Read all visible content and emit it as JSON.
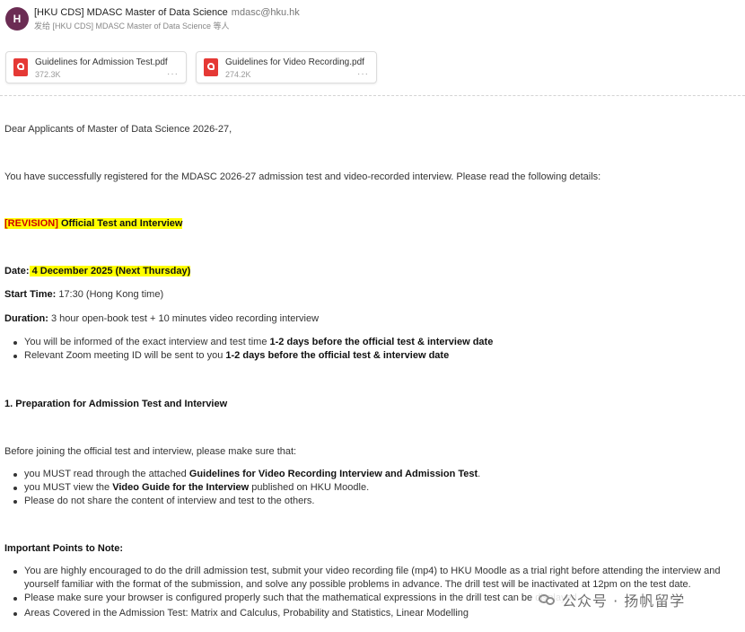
{
  "header": {
    "avatar_letter": "H",
    "subject": "[HKU CDS] MDASC Master of Data Science",
    "sender": "mdasc@hku.hk",
    "to_line": "发给 [HKU CDS] MDASC Master of Data Science 等人"
  },
  "attachments": [
    {
      "name": "Guidelines for Admission Test.pdf",
      "size": "372.3K",
      "more": "···"
    },
    {
      "name": "Guidelines for Video Recording.pdf",
      "size": "274.2K",
      "more": "···"
    }
  ],
  "email": {
    "greeting": "Dear Applicants of Master of Data Science 2026-27,",
    "intro": "You have successfully registered for the MDASC 2026-27 admission test and video-recorded interview. Please read the following details:",
    "revision_tag": "[REVISION]",
    "revision_title": " Official Test and Interview",
    "date_label": "Date:",
    "date_value": " 4 December 2025 (Next Thursday)",
    "start_label": "Start Time:",
    "start_value": " 17:30 (Hong Kong time)",
    "duration_label": "Duration:",
    "duration_value": " 3 hour open-book test + 10 minutes video recording interview",
    "bullets1": [
      {
        "pre": "You will be informed of the exact interview and test time ",
        "bold": "1-2 days before the official test & interview date"
      },
      {
        "pre": "Relevant Zoom meeting ID will be sent to you ",
        "bold": "1-2 days before the official test & interview date"
      }
    ],
    "section1_title": "1. Preparation for Admission Test and Interview",
    "before_text": "Before joining the official test and interview, please make sure that:",
    "bullets2": [
      {
        "pre": "you MUST read through the attached ",
        "bold": "Guidelines for Video Recording Interview and Admission Test",
        "post": "."
      },
      {
        "pre": "you MUST view the ",
        "bold": "Video Guide for the Interview",
        "post": " published on HKU Moodle."
      },
      {
        "pre": "Please do not share the content of interview and test to the others.",
        "bold": "",
        "post": ""
      }
    ],
    "important_title": "Important Points to Note:",
    "bullets3": [
      "You are highly encouraged to do the drill admission test, submit your video recording file (mp4) to HKU Moodle as a trial right before attending the interview and",
      "Please make sure your browser is configured properly such that the mathematical expressions in the drill test can be displayed.",
      "Areas Covered in the Admission Test: Matrix and Calculus, Probability and Statistics, Linear Modelling"
    ],
    "bullet3_cont": "yourself familiar with the format of the submission, and solve any possible problems in advance. The drill test will be inactivated at 12pm on the test date."
  },
  "watermark": {
    "text": "公众号 · 扬帆留学",
    "icon": "wechat-icon"
  },
  "colors": {
    "highlight": "#ffff00",
    "revision_red": "#d00000",
    "avatar": "#6b2c53",
    "pdf_red": "#e53935"
  }
}
